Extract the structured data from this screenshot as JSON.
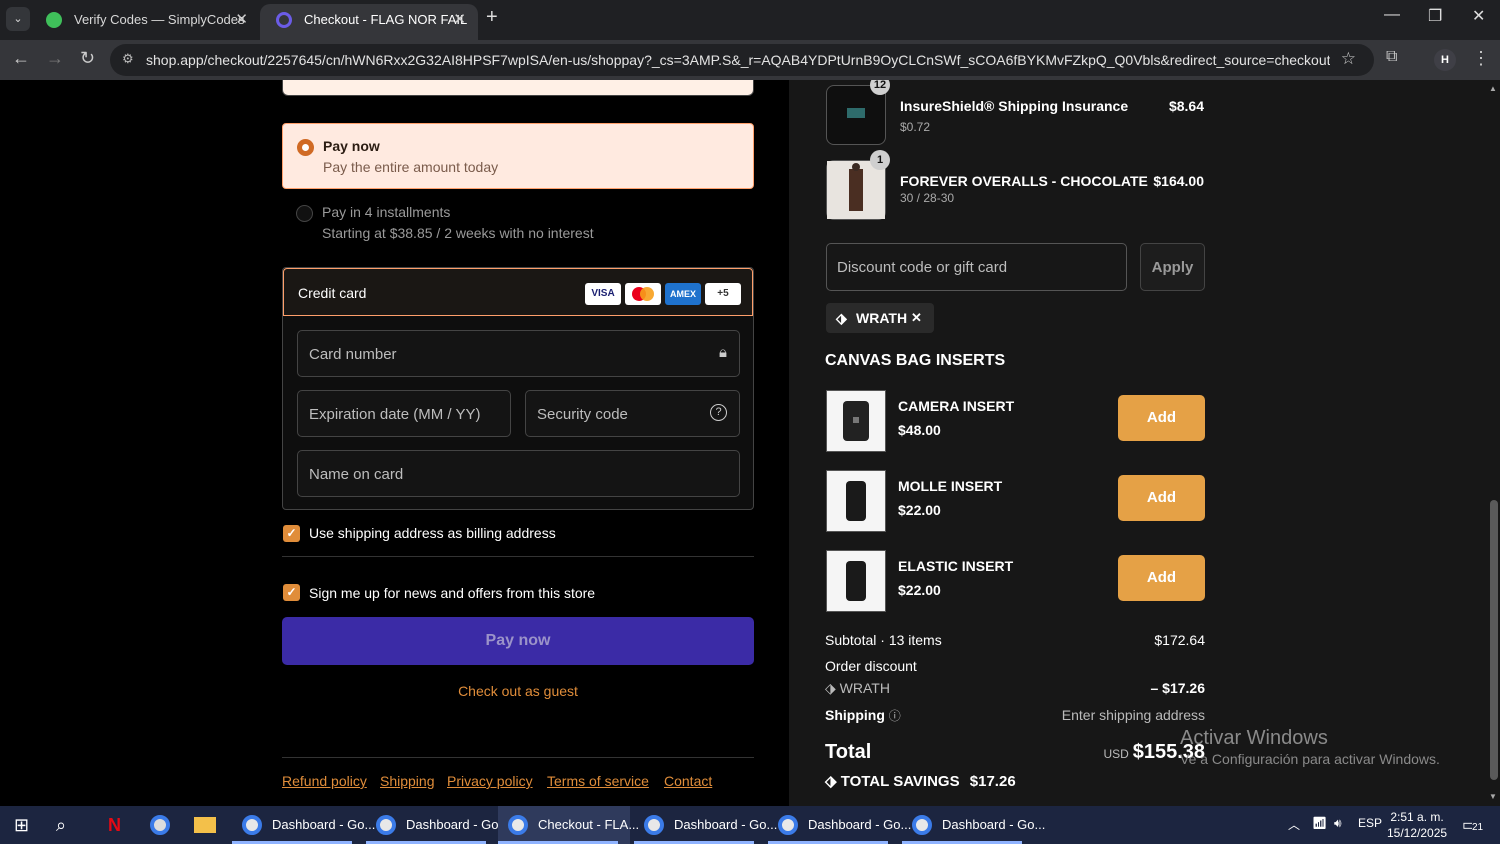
{
  "browser": {
    "tabs": [
      {
        "title": "Verify Codes — SimplyCodes",
        "active": false
      },
      {
        "title": "Checkout - FLAG NOR FAIL",
        "active": true
      }
    ],
    "url": "shop.app/checkout/2257645/cn/hWN6Rxx2G32AI8HPSF7wpISA/en-us/shoppay?_cs=3AMP.S&_r=AQAB4YDPtUrnB9OyCLCnSWf_sCOA6fBYKMvFZkpQ_Q0Vbls&redirect_source=checkout_automatic_redir...",
    "profile_initial": "H"
  },
  "payment": {
    "pay_now_title": "Pay now",
    "pay_now_sub": "Pay the entire amount today",
    "installments_title": "Pay in 4 installments",
    "installments_sub": "Starting at $38.85 / 2 weeks with no interest",
    "credit_card_label": "Credit card",
    "card_badges": [
      "VISA",
      "",
      "AMEX",
      "+5"
    ],
    "card_number_placeholder": "Card number",
    "expiration_placeholder": "Expiration date (MM / YY)",
    "security_placeholder": "Security code",
    "name_placeholder": "Name on card",
    "billing_checkbox": "Use shipping address as billing address",
    "news_checkbox": "Sign me up for news and offers from this store",
    "pay_button": "Pay now",
    "guest_link": "Check out as guest",
    "footer_links": [
      "Refund policy",
      "Shipping",
      "Privacy policy",
      "Terms of service",
      "Contact"
    ]
  },
  "order": {
    "items": [
      {
        "qty": "12",
        "name": "InsureShield® Shipping Insurance",
        "sub": "$0.72",
        "price": "$8.64"
      },
      {
        "qty": "1",
        "name": "FOREVER OVERALLS - CHOCOLATE",
        "sub": "30 / 28-30",
        "price": "$164.00"
      }
    ],
    "discount_placeholder": "Discount code or gift card",
    "apply_label": "Apply",
    "applied_code": "WRATH",
    "upsell_title": "CANVAS BAG INSERTS",
    "upsells": [
      {
        "name": "CAMERA INSERT",
        "price": "$48.00",
        "button": "Add"
      },
      {
        "name": "MOLLE INSERT",
        "price": "$22.00",
        "button": "Add"
      },
      {
        "name": "ELASTIC INSERT",
        "price": "$22.00",
        "button": "Add"
      }
    ],
    "subtotal_label": "Subtotal · 13 items",
    "subtotal_value": "$172.64",
    "order_discount_label": "Order discount",
    "discount_code_label": "WRATH",
    "discount_value": "– $17.26",
    "shipping_label": "Shipping",
    "shipping_value": "Enter shipping address",
    "total_label": "Total",
    "currency": "USD",
    "total_value": "$155.38",
    "savings_label": "TOTAL SAVINGS",
    "savings_value": "$17.26"
  },
  "watermark": {
    "line1": "Activar Windows",
    "line2": "Ve a Configuración para activar Windows."
  },
  "taskbar": {
    "apps": [
      "Dashboard - Go...",
      "Dashboard - Go...",
      "Checkout - FLA...",
      "Dashboard - Go...",
      "Dashboard - Go...",
      "Dashboard - Go..."
    ],
    "language": "ESP",
    "time": "2:51 a. m.",
    "date": "15/12/2025",
    "notifications": "21"
  },
  "colors": {
    "accent_orange": "#e08d3a",
    "pay_button": "#3b2ba6",
    "add_button": "#e5a146"
  }
}
